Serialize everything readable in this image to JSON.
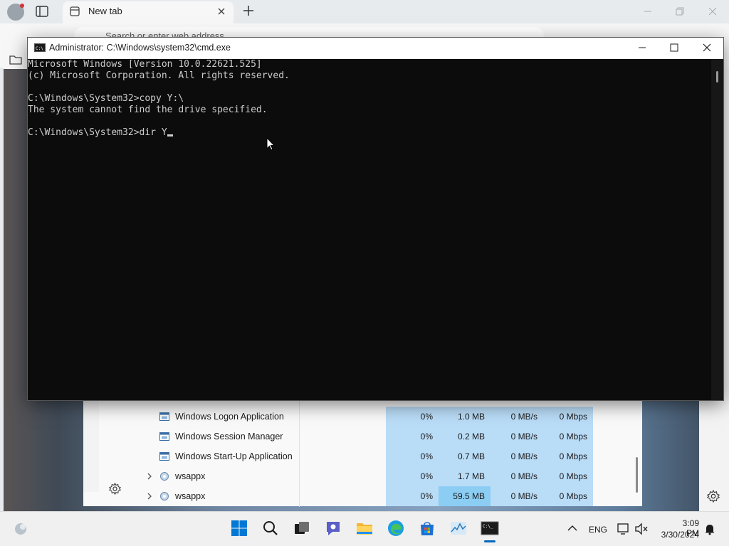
{
  "browser": {
    "tab_title": "New tab",
    "address_placeholder": "Search or enter web address"
  },
  "cmd": {
    "title": "Administrator: C:\\Windows\\system32\\cmd.exe",
    "lines": [
      "Microsoft Windows [Version 10.0.22621.525]",
      "(c) Microsoft Corporation. All rights reserved.",
      "",
      "C:\\Windows\\System32>copy Y:\\",
      "The system cannot find the drive specified.",
      "",
      "C:\\Windows\\System32>dir Y"
    ]
  },
  "task_manager": {
    "rows": [
      {
        "name": "Windows Logon Application",
        "expandable": false,
        "cpu": "0%",
        "memory": "1.0 MB",
        "disk": "0 MB/s",
        "network": "0 Mbps"
      },
      {
        "name": "Windows Session Manager",
        "expandable": false,
        "cpu": "0%",
        "memory": "0.2 MB",
        "disk": "0 MB/s",
        "network": "0 Mbps"
      },
      {
        "name": "Windows Start-Up Application",
        "expandable": false,
        "cpu": "0%",
        "memory": "0.7 MB",
        "disk": "0 MB/s",
        "network": "0 Mbps"
      },
      {
        "name": "wsappx",
        "expandable": true,
        "cpu": "0%",
        "memory": "1.7 MB",
        "disk": "0 MB/s",
        "network": "0 Mbps"
      },
      {
        "name": "wsappx",
        "expandable": true,
        "cpu": "0%",
        "memory": "59.5 MB",
        "disk": "0 MB/s",
        "network": "0 Mbps"
      }
    ]
  },
  "taskbar": {
    "pinned": [
      "start-icon",
      "search-icon",
      "task-view-icon",
      "teams-chat-icon",
      "file-explorer-icon",
      "edge-icon",
      "microsoft-store-icon",
      "task-manager-icon",
      "command-prompt-icon"
    ],
    "language": "ENG",
    "time": "3:09 PM",
    "date": "3/30/2024"
  }
}
